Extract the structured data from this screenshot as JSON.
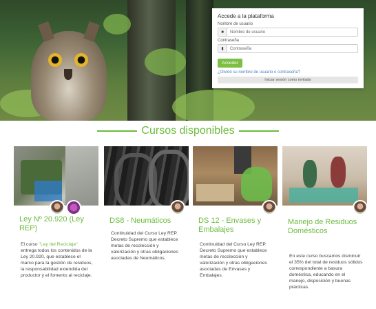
{
  "login": {
    "title": "Accede a la plataforma",
    "username_label": "Nombre de usuario",
    "username_placeholder": "Nombre de usuario",
    "password_label": "Contraseña",
    "password_placeholder": "Contraseña",
    "submit_label": "Acceder",
    "forgot_link": "¿Olvidó su nombre de usuario o contraseña?",
    "guest_label": "Iniciar sesión como invitado"
  },
  "section_title": "Cursos disponibles",
  "courses": [
    {
      "title": "Ley Nº 20.920 (Ley REP)",
      "desc_prefix": "El curso ",
      "desc_highlight": "\"Ley del Reciclaje\"",
      "desc_rest": " entrega todos los contenidos de la Ley 20.920, que establece el marco para la gestión de residuos, la responsabilidad extendida del productor y el fomento al reciclaje."
    },
    {
      "title": "DS8 - Neumáticos",
      "desc": "Continuidad del Curso Ley REP. Decreto Supremo que establece metas de recolección y valorización y otras obligaciones asociadas de Neumáticos."
    },
    {
      "title": "DS 12 - Envases y Embalajes",
      "desc": "Continuidad del Curso Ley REP. Decreto Supremo que establece metas de recolección y valorización y otras obligaciones asociadas de Envases y Embalajes."
    },
    {
      "title": "Manejo de Residuos Domésticos",
      "desc": "En este curso buscamos disminuir el 35% del total de residuos sólidos correspondiente a basura doméstica, educando en el manejo, disposición y buenas prácticas."
    }
  ],
  "colors": {
    "accent": "#6bbb3c",
    "button": "#7bc043",
    "link": "#4a7fc1"
  }
}
